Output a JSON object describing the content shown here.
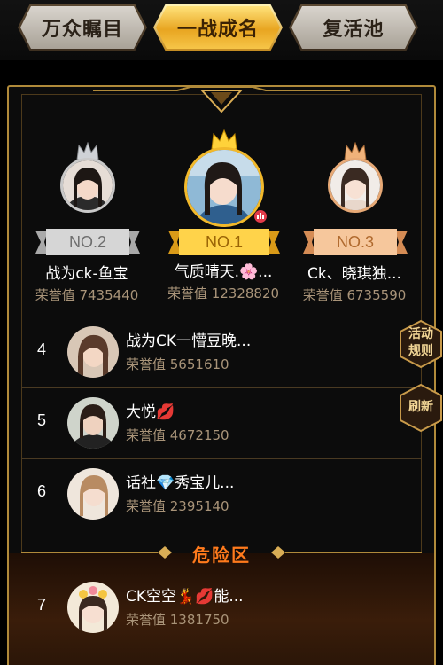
{
  "tabs": [
    {
      "label": "万众瞩目",
      "active": false
    },
    {
      "label": "一战成名",
      "active": true
    },
    {
      "label": "复活池",
      "active": false
    }
  ],
  "podium": [
    {
      "rank_label": "NO.2",
      "name": "战为ck-鱼宝",
      "score": "荣誉值 7435440",
      "crown": "silver-crown-icon"
    },
    {
      "rank_label": "NO.1",
      "name": "气质晴天.🌸...",
      "score": "荣誉值 12328820",
      "crown": "gold-crown-icon"
    },
    {
      "rank_label": "NO.3",
      "name": "Ck、晓琪独...",
      "score": "荣誉值 6735590",
      "crown": "bronze-crown-icon"
    }
  ],
  "list": [
    {
      "rank": "4",
      "name": "战为CK一懵豆晚...",
      "score": "荣誉值 5651610"
    },
    {
      "rank": "5",
      "name": "大悦💋",
      "score": "荣誉值 4672150"
    },
    {
      "rank": "6",
      "name": "话社💎秀宝儿...",
      "score": "荣誉值 2395140"
    },
    {
      "rank": "7",
      "name": "CK空空💃💋能...",
      "score": "荣誉值 1381750"
    }
  ],
  "danger_zone": {
    "label": "危险区"
  },
  "side_buttons": {
    "rules": "活动\n规则",
    "refresh": "刷新"
  },
  "colors": {
    "gold": "#e8a521",
    "frame": "#b08a3a",
    "score_text": "#a99479",
    "danger": "#ff7a1c"
  }
}
